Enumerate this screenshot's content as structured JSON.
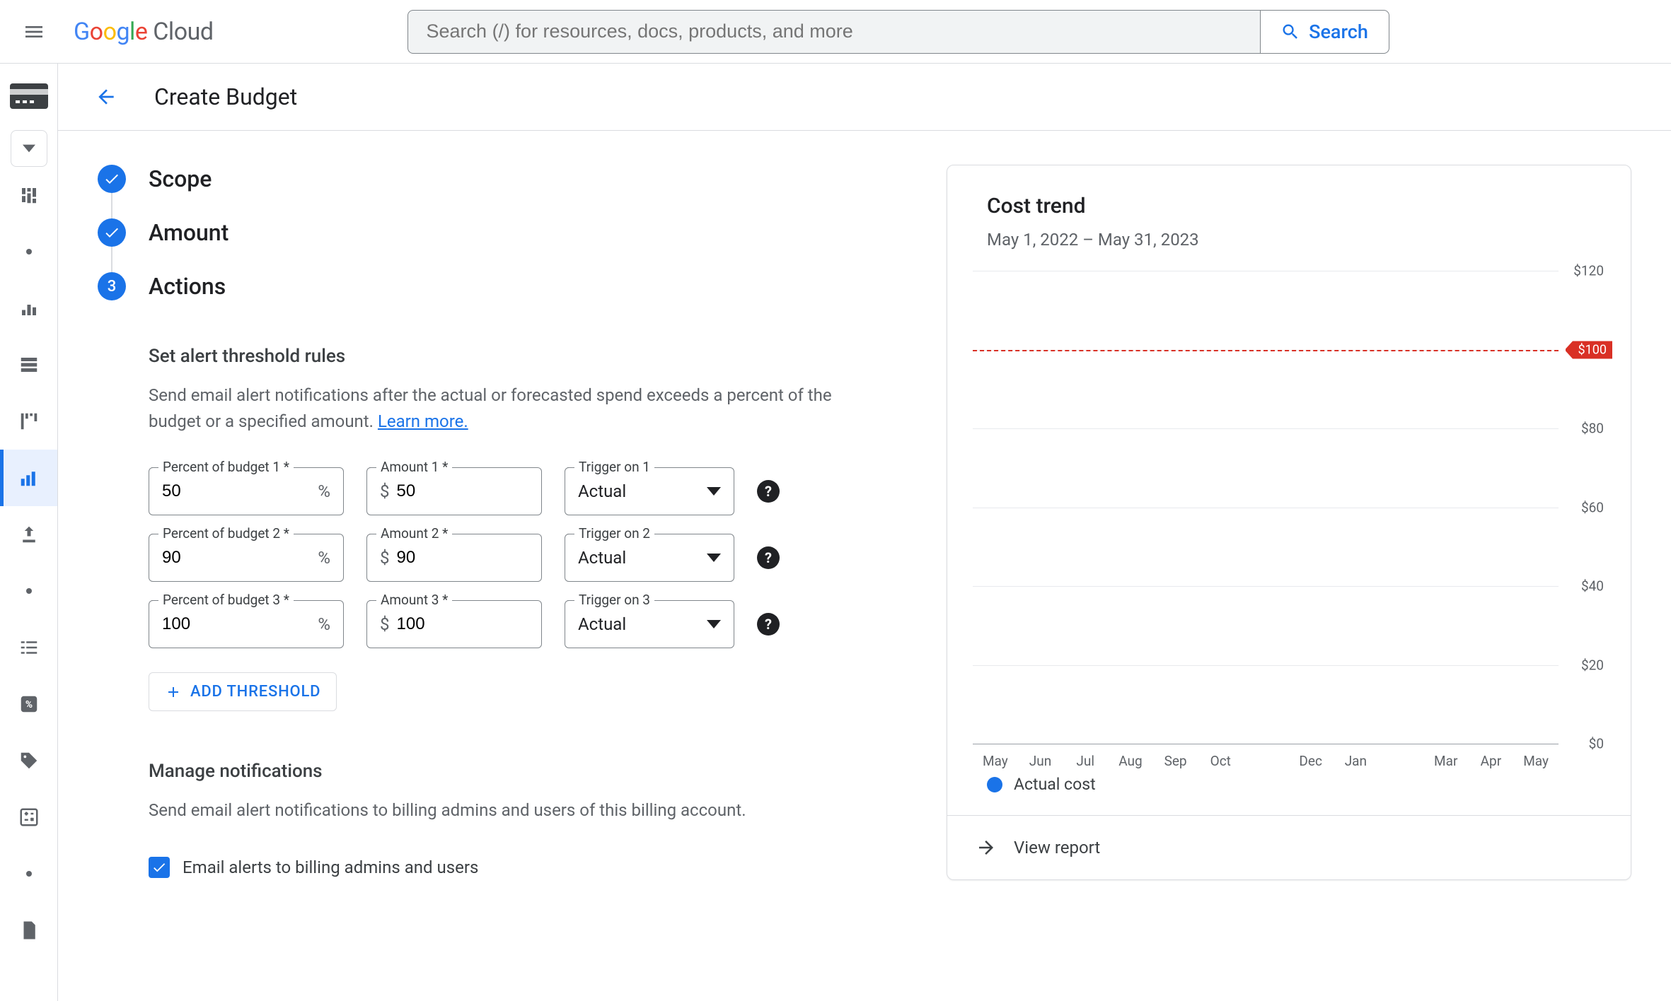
{
  "header": {
    "product": "Cloud",
    "search_placeholder": "Search (/) for resources, docs, products, and more",
    "search_button": "Search"
  },
  "page": {
    "title": "Create Budget",
    "steps": {
      "scope": "Scope",
      "amount": "Amount",
      "actions": "Actions",
      "actions_number": "3"
    }
  },
  "thresholds": {
    "heading": "Set alert threshold rules",
    "description": "Send email alert notifications after the actual or forecasted spend exceeds a percent of the budget or a specified amount. ",
    "learn_more": "Learn more.",
    "rows": [
      {
        "percent_label": "Percent of budget 1 *",
        "percent": "50",
        "amount_label": "Amount 1 *",
        "amount": "50",
        "trigger_label": "Trigger on 1",
        "trigger": "Actual"
      },
      {
        "percent_label": "Percent of budget 2 *",
        "percent": "90",
        "amount_label": "Amount 2 *",
        "amount": "90",
        "trigger_label": "Trigger on 2",
        "trigger": "Actual"
      },
      {
        "percent_label": "Percent of budget 3 *",
        "percent": "100",
        "amount_label": "Amount 3 *",
        "amount": "100",
        "trigger_label": "Trigger on 3",
        "trigger": "Actual"
      }
    ],
    "add_label": "ADD THRESHOLD",
    "currency": "$",
    "percent_suffix": "%"
  },
  "notifications": {
    "heading": "Manage notifications",
    "description": "Send email alert notifications to billing admins and users of this billing account.",
    "checkbox_label": "Email alerts to billing admins and users",
    "checked": true
  },
  "cost_trend": {
    "title": "Cost trend",
    "range": "May 1, 2022 – May 31, 2023",
    "legend_label": "Actual cost",
    "view_report": "View report",
    "budget_tag": "$100"
  },
  "chart_data": {
    "type": "bar",
    "title": "Cost trend",
    "xlabel": "",
    "ylabel": "",
    "ylim": [
      0,
      120
    ],
    "y_ticks": [
      0,
      20,
      40,
      60,
      80,
      100,
      120
    ],
    "y_tick_labels": [
      "$0",
      "$20",
      "$40",
      "$60",
      "$80",
      "$100",
      "$120"
    ],
    "categories": [
      "May",
      "Jun",
      "Jul",
      "Aug",
      "Sep",
      "Oct",
      "",
      "Dec",
      "Jan",
      "",
      "Mar",
      "Apr",
      "May"
    ],
    "series": [
      {
        "name": "Actual cost",
        "values": [
          0,
          0,
          0,
          0,
          0,
          0,
          0,
          0,
          0,
          0,
          0,
          0,
          0
        ]
      }
    ],
    "reference_lines": [
      {
        "label": "$100",
        "value": 100,
        "style": "dashed",
        "color": "#d93025"
      }
    ]
  }
}
